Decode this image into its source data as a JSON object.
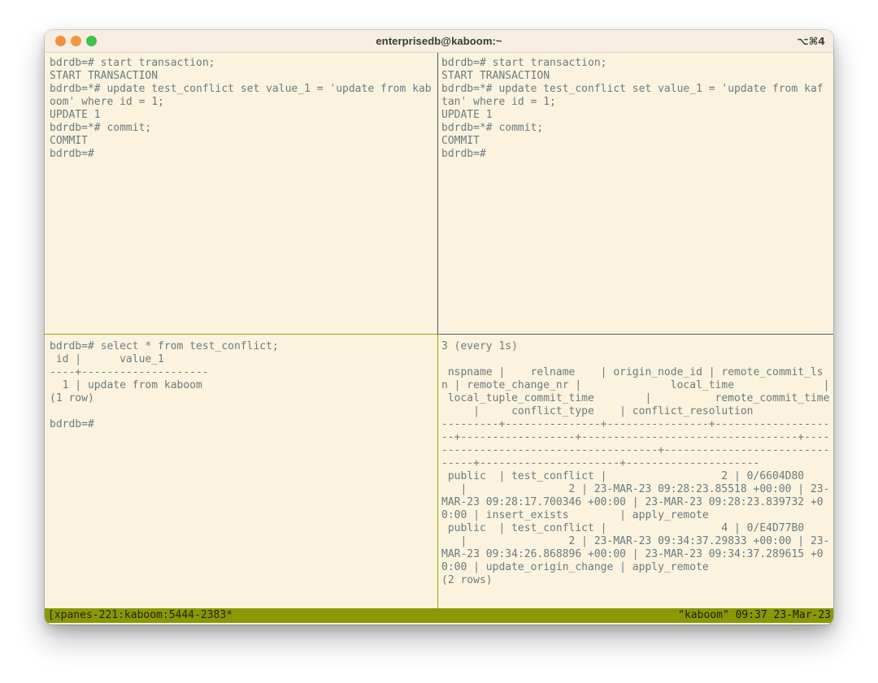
{
  "window": {
    "title": "enterprisedb@kaboom:~",
    "shortcut": "⌥⌘4"
  },
  "panes": {
    "top_left": {
      "lines": [
        "bdrdb=# start transaction;",
        "START TRANSACTION",
        "bdrdb=*# update test_conflict set value_1 = 'update from kab",
        "oom' where id = 1;",
        "UPDATE 1",
        "bdrdb=*# commit;",
        "COMMIT",
        "bdrdb=#"
      ]
    },
    "top_right": {
      "lines": [
        "bdrdb=# start transaction;",
        "START TRANSACTION",
        "bdrdb=*# update test_conflict set value_1 = 'update from kaf",
        "tan' where id = 1;",
        "UPDATE 1",
        "bdrdb=*# commit;",
        "COMMIT",
        "bdrdb=#"
      ]
    },
    "bottom_left": {
      "lines": [
        "bdrdb=# select * from test_conflict;",
        " id |      value_1",
        "----+--------------------",
        "  1 | update from kaboom",
        "(1 row)",
        "",
        "bdrdb=#"
      ]
    },
    "bottom_right": {
      "lines": [
        "3 (every 1s)",
        "",
        " nspname |    relname    | origin_node_id | remote_commit_ls",
        "n | remote_change_nr |              local_time              |",
        " local_tuple_commit_time        |          remote_commit_time",
        "     |     conflict_type    | conflict_resolution",
        "---------+---------------+----------------+------------------",
        "--+------------------+----------------------------------+----",
        "----------------------------------+--------------------------",
        "-----+----------------------+---------------------",
        " public  | test_conflict |                  2 | 0/6604D80",
        "   |                2 | 23-MAR-23 09:28:23.85518 +00:00 | 23-",
        "MAR-23 09:28:17.700346 +00:00 | 23-MAR-23 09:28:23.839732 +0",
        "0:00 | insert_exists        | apply_remote",
        " public  | test_conflict |                  4 | 0/E4D77B0",
        "   |                2 | 23-MAR-23 09:34:37.29833 +00:00 | 23-",
        "MAR-23 09:34:26.868896 +00:00 | 23-MAR-23 09:34:37.289615 +0",
        "0:00 | update_origin_change | apply_remote",
        "(2 rows)"
      ]
    }
  },
  "status_bar": {
    "left": "[xpanes-221:kaboom:5444-2383*",
    "right": "\"kaboom\" 09:37 23-Mar-23"
  },
  "colors": {
    "terminal_bg": "#fbf3dd",
    "titlebar_bg": "#f8ede1",
    "text": "#6a7b82",
    "status_bar_bg": "#899803",
    "status_bar_text": "#20280a",
    "active_pane_border": "#98a702",
    "inactive_pane_border": "#4e5f6a",
    "traffic_close": "#f2903e",
    "traffic_minimize": "#f3973e",
    "traffic_zoom": "#3cc34a"
  }
}
